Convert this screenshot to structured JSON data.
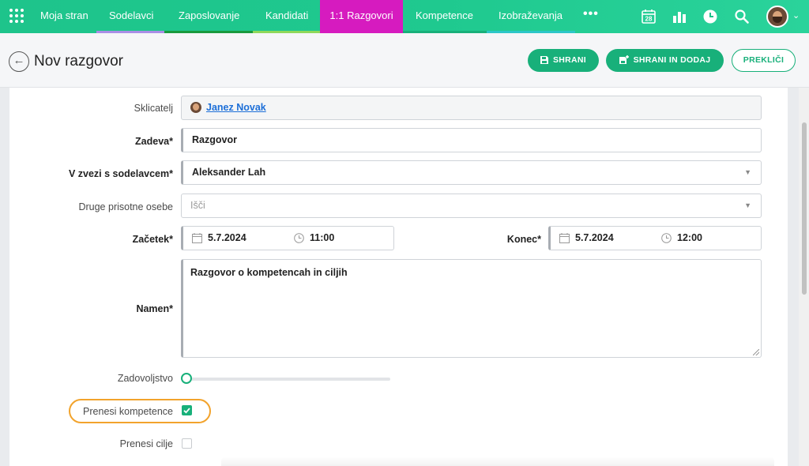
{
  "nav": {
    "items": [
      {
        "label": "Moja stran"
      },
      {
        "label": "Sodelavci"
      },
      {
        "label": "Zaposlovanje"
      },
      {
        "label": "Kandidati"
      },
      {
        "label": "1:1 Razgovori"
      },
      {
        "label": "Kompetence"
      },
      {
        "label": "Izobraževanja"
      }
    ],
    "active_index": 4,
    "more": "•••",
    "calendar_day": "28",
    "active_color": "#d61bbf",
    "bar_color": "#1ec48b"
  },
  "header": {
    "title": "Nov razgovor",
    "save": "SHRANI",
    "save_add": "SHRANI IN DODAJ",
    "cancel": "PREKLIČI"
  },
  "form": {
    "referrer": {
      "label": "Sklicatelj",
      "value": "Janez Novak"
    },
    "subject": {
      "label": "Zadeva*",
      "value": "Razgovor"
    },
    "employee": {
      "label": "V zvezi s sodelavcem*",
      "value": "Aleksander Lah"
    },
    "others": {
      "label": "Druge prisotne osebe",
      "placeholder": "Išči"
    },
    "start": {
      "label": "Začetek*",
      "date": "5.7.2024",
      "time": "11:00"
    },
    "end": {
      "label": "Konec*",
      "date": "5.7.2024",
      "time": "12:00"
    },
    "purpose": {
      "label": "Namen*",
      "value": "Razgovor o kompetencah in ciljih"
    },
    "satisfaction": {
      "label": "Zadovoljstvo",
      "value": 0
    },
    "transfer_competences": {
      "label": "Prenesi kompetence",
      "checked": true
    },
    "transfer_goals": {
      "label": "Prenesi cilje",
      "checked": false
    }
  },
  "colors": {
    "accent": "#18b07a",
    "highlight": "#f2a32c",
    "link": "#1d6fd8"
  }
}
